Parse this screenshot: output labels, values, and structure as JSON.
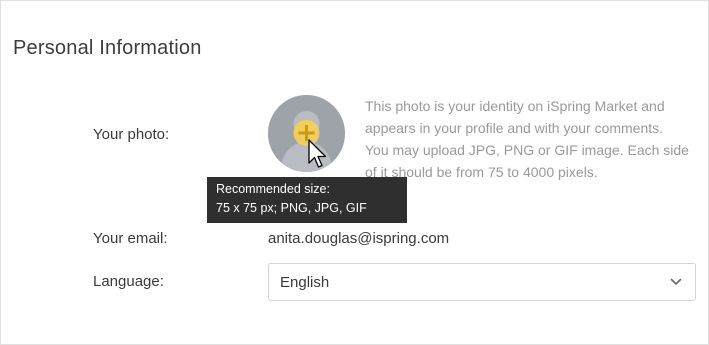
{
  "section": {
    "title": "Personal Information"
  },
  "photo": {
    "label": "Your photo:",
    "description_line1": "This photo is your identity on iSpring Market and appears in your profile and with your comments.",
    "description_line2": "You may upload JPG, PNG or GIF image. Each side of it should be from 75 to 4000 pixels.",
    "tooltip_line1": "Recommended size:",
    "tooltip_line2": "75 x 75 px; PNG, JPG, GIF",
    "add_icon": "plus-icon",
    "avatar_placeholder": "person-silhouette"
  },
  "email": {
    "label": "Your email:",
    "value": "anita.douglas@ispring.com"
  },
  "language": {
    "label": "Language:",
    "selected": "English",
    "dropdown_icon": "chevron-down-icon"
  },
  "colors": {
    "plus_badge": "#f2cf5b",
    "tooltip_bg": "#2f2f2f",
    "muted_text": "#9a9a9a"
  }
}
